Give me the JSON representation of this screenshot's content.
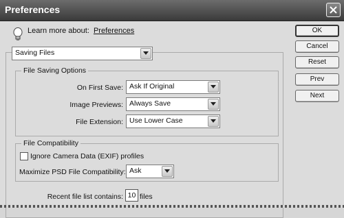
{
  "window": {
    "title": "Preferences"
  },
  "learn": {
    "prefix": "Learn more about:",
    "link": "Preferences"
  },
  "buttons": {
    "ok": "OK",
    "cancel": "Cancel",
    "reset": "Reset",
    "prev": "Prev",
    "next": "Next"
  },
  "section": {
    "selected": "Saving Files"
  },
  "file_saving": {
    "title": "File Saving Options",
    "on_first_save": {
      "label": "On First Save:",
      "value": "Ask If Original"
    },
    "image_previews": {
      "label": "Image Previews:",
      "value": "Always Save"
    },
    "file_extension": {
      "label": "File Extension:",
      "value": "Use Lower Case"
    }
  },
  "compatibility": {
    "title": "File Compatibility",
    "ignore_exif": {
      "label": "Ignore Camera Data (EXIF) profiles",
      "checked": false
    },
    "maximize_psd": {
      "label": "Maximize PSD File Compatibility:",
      "value": "Ask"
    }
  },
  "recent": {
    "label": "Recent file list contains:",
    "value": "10",
    "suffix": "files"
  }
}
